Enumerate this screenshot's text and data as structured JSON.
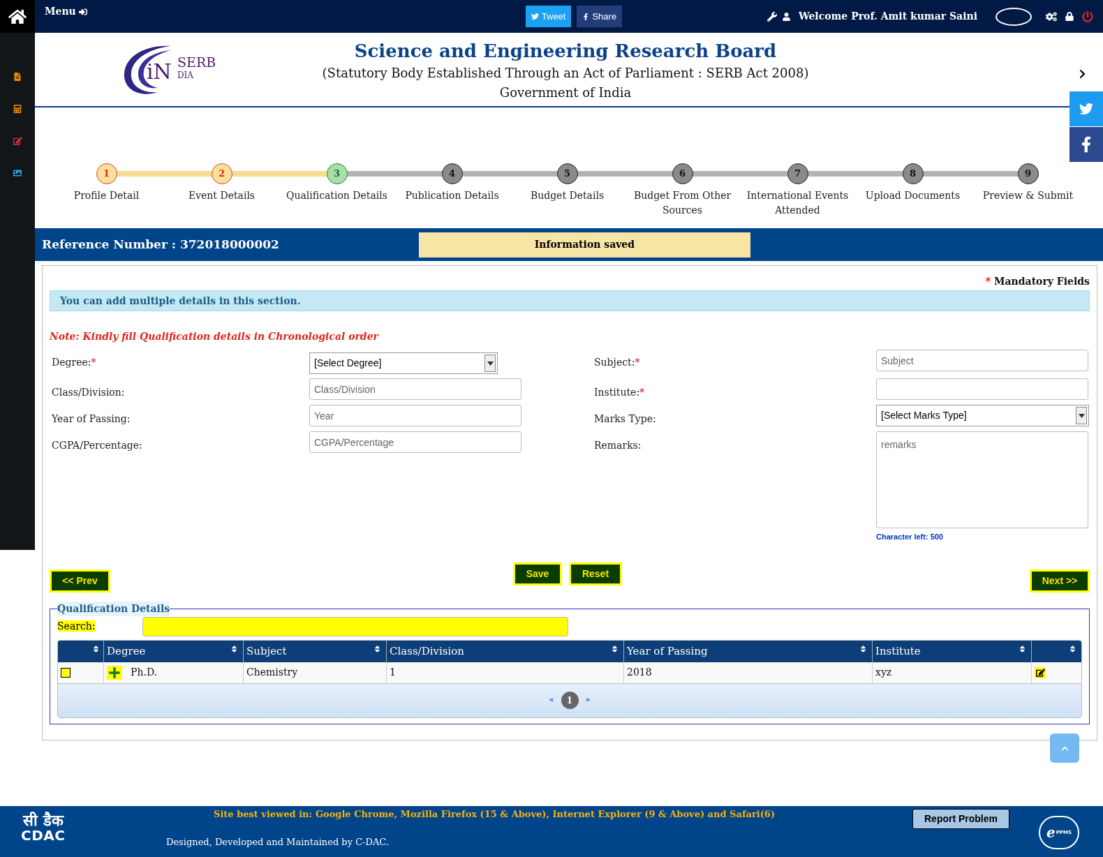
{
  "topbar": {
    "menu": "Menu",
    "tweet": "Tweet",
    "share": "Share",
    "welcome": "Welcome Prof. Amit kumar Saini"
  },
  "header": {
    "logo": {
      "initial": "iN",
      "name": "SERB",
      "suffix": "DIA"
    },
    "title": "Science and Engineering Research Board",
    "subtitle": "(Statutory Body Established Through an Act of Parliament : SERB Act 2008)",
    "government": "Government of India"
  },
  "steps": [
    {
      "number": "1",
      "label": "Profile Detail",
      "completed": true,
      "selected": false
    },
    {
      "number": "2",
      "label": "Event Details",
      "completed": true,
      "selected": false
    },
    {
      "number": "3",
      "label": "Qualification Details",
      "completed": false,
      "selected": true
    },
    {
      "number": "4",
      "label": "Publication Details",
      "completed": false,
      "selected": false
    },
    {
      "number": "5",
      "label": "Budget Details",
      "completed": false,
      "selected": false
    },
    {
      "number": "6",
      "label": "Budget From Other Sources",
      "completed": false,
      "selected": false
    },
    {
      "number": "7",
      "label": "International Events Attended",
      "completed": false,
      "selected": false
    },
    {
      "number": "8",
      "label": "Upload Documents",
      "completed": false,
      "selected": false
    },
    {
      "number": "9",
      "label": "Preview & Submit",
      "completed": false,
      "selected": false
    }
  ],
  "reference": "Reference Number : 372018000002",
  "notice": "Information saved",
  "mandatory": {
    "mark": "*",
    "text": "Mandatory Fields"
  },
  "info": "You can add multiple details in this section.",
  "note": "Note: Kindly fill Qualification details in Chronological order",
  "form_rows": [
    {
      "left": {
        "label": "Degree:",
        "required_mark": "*",
        "kind": "select",
        "value": "[Select Degree]"
      },
      "right": {
        "label": "Subject:",
        "required_mark": "*",
        "kind": "input",
        "placeholder": "Subject"
      }
    },
    {
      "left": {
        "label": "Class/Division:",
        "kind": "input",
        "placeholder": "Class/Division"
      },
      "right": {
        "label": "Institute:",
        "required_mark": "*",
        "kind": "input"
      }
    },
    {
      "left": {
        "label": "Year of Passing:",
        "kind": "input",
        "placeholder": "Year"
      },
      "right": {
        "label": "Marks Type:",
        "kind": "select",
        "value": "[Select Marks Type]"
      }
    },
    {
      "left": {
        "label": "CGPA/Percentage:",
        "kind": "input",
        "placeholder": "CGPA/Percentage"
      },
      "right": {
        "label": "Remarks:",
        "kind": "textarea",
        "placeholder": "remarks"
      }
    }
  ],
  "char_counter": "Character left: 500",
  "buttons": {
    "prev": "<< Prev",
    "save": "Save",
    "reset": "Reset",
    "next": "Next >>"
  },
  "qualification_table": {
    "legend": "Qualification Details",
    "search_label": "Search:",
    "columns": [
      "Degree",
      "Subject",
      "Class/Division",
      "Year of Passing",
      "Institute"
    ],
    "rows": [
      {
        "checked": false,
        "degree": "Ph.D.",
        "subject": "Chemistry",
        "class_division": "1",
        "year": "2018",
        "institute": "xyz"
      }
    ],
    "pagination": {
      "prev": "«",
      "pages": [
        {
          "label": "1",
          "selected": true
        }
      ],
      "next": "»"
    }
  },
  "footer": {
    "cdac_hindi": "सी डैक",
    "cdac": "CDAC",
    "browsers": "Site best viewed in: Google Chrome, Mozilla Firefox (15 & Above), Internet Explorer (9 & Above) and Safari(6)",
    "credit": "Designed, Developed and Maintained by C-DAC.",
    "report": "Report Problem",
    "eppms_e": "e",
    "eppms": "PPMS"
  }
}
